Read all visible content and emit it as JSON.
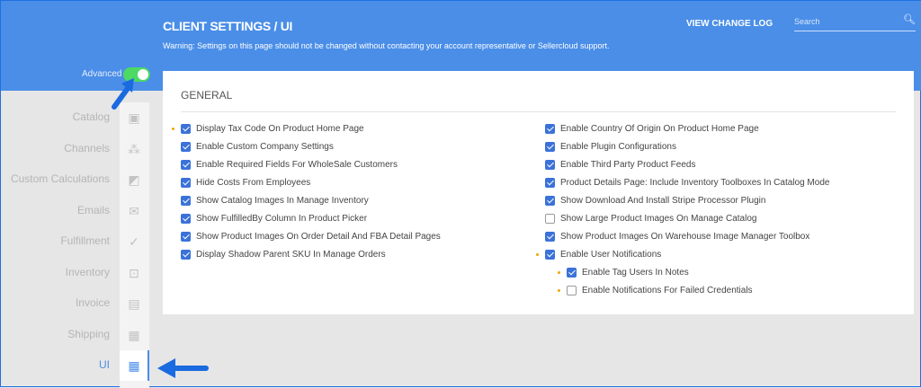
{
  "header": {
    "title": "CLIENT SETTINGS / UI",
    "warning": "Warning: Settings on this page should not be changed without contacting your account representative or Sellercloud support.",
    "change_log": "VIEW CHANGE LOG",
    "search_placeholder": "Search"
  },
  "advanced": {
    "label": "Advanced",
    "on": true
  },
  "sidebar": {
    "items": [
      {
        "label": "Catalog",
        "icon": "catalog-icon"
      },
      {
        "label": "Channels",
        "icon": "channels-icon"
      },
      {
        "label": "Custom Calculations",
        "icon": "calculations-icon"
      },
      {
        "label": "Emails",
        "icon": "email-settings-icon"
      },
      {
        "label": "Fulfillment",
        "icon": "check-circle-icon"
      },
      {
        "label": "Inventory",
        "icon": "dolly-icon"
      },
      {
        "label": "Invoice",
        "icon": "document-icon"
      },
      {
        "label": "Shipping",
        "icon": "box-icon"
      },
      {
        "label": "UI",
        "icon": "dashboard-icon",
        "active": true
      }
    ]
  },
  "section": {
    "title": "GENERAL",
    "left": [
      {
        "label": "Display Tax Code On Product Home Page",
        "checked": true,
        "dot": true
      },
      {
        "label": "Enable Custom Company Settings",
        "checked": true
      },
      {
        "label": "Enable Required Fields For WholeSale Customers",
        "checked": true
      },
      {
        "label": "Hide Costs From Employees",
        "checked": true
      },
      {
        "label": "Show Catalog Images In Manage Inventory",
        "checked": true
      },
      {
        "label": "Show FulfilledBy Column In Product Picker",
        "checked": true
      },
      {
        "label": "Show Product Images On Order Detail And FBA Detail Pages",
        "checked": true
      },
      {
        "label": "Display Shadow Parent SKU In Manage Orders",
        "checked": true
      }
    ],
    "right": [
      {
        "label": "Enable Country Of Origin On Product Home Page",
        "checked": true
      },
      {
        "label": "Enable Plugin Configurations",
        "checked": true
      },
      {
        "label": "Enable Third Party Product Feeds",
        "checked": true
      },
      {
        "label": "Product Details Page: Include Inventory Toolboxes In Catalog Mode",
        "checked": true
      },
      {
        "label": "Show Download And Install Stripe Processor Plugin",
        "checked": true
      },
      {
        "label": "Show Large Product Images On Manage Catalog",
        "checked": false
      },
      {
        "label": "Show Product Images On Warehouse Image Manager Toolbox",
        "checked": true
      },
      {
        "label": "Enable User Notifications",
        "checked": true,
        "dot": true
      },
      {
        "label": "Enable Tag Users In Notes",
        "checked": true,
        "dot": true,
        "indent": true
      },
      {
        "label": "Enable Notifications For Failed Credentials",
        "checked": false,
        "dot": true,
        "indent": true
      }
    ]
  },
  "colors": {
    "header": "#4a8ee8",
    "accent": "#3b72d9",
    "toggle": "#4cd964",
    "dot": "#f0a500"
  }
}
